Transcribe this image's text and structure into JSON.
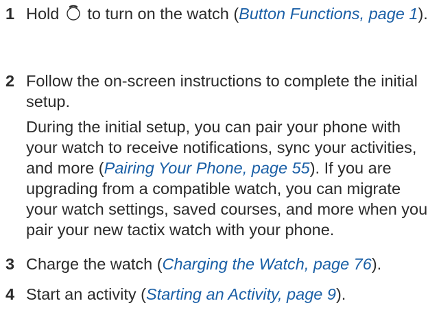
{
  "steps": [
    {
      "number": "1",
      "pre": "Hold",
      "icon": "watch-button-icon",
      "mid": "to turn on the watch (",
      "link": "Button Functions, page 1",
      "post": ")."
    },
    {
      "number": "2",
      "text": "Follow the on-screen instructions to complete the initial setup.",
      "detail_pre": "During the initial setup, you can pair your phone with your watch to receive notifications, sync your activities, and more (",
      "detail_link": "Pairing Your Phone, page 55",
      "detail_post": "). If you are upgrading from a compatible watch, you can migrate your watch settings, saved courses, and more when you pair your new tactix watch with your phone."
    },
    {
      "number": "3",
      "pre": "Charge the watch (",
      "link": "Charging the Watch, page 76",
      "post": ")."
    },
    {
      "number": "4",
      "pre": "Start an activity (",
      "link": "Starting an Activity, page 9",
      "post": ")."
    }
  ],
  "colors": {
    "text": "#2b2b2b",
    "link": "#1a5fa6"
  }
}
